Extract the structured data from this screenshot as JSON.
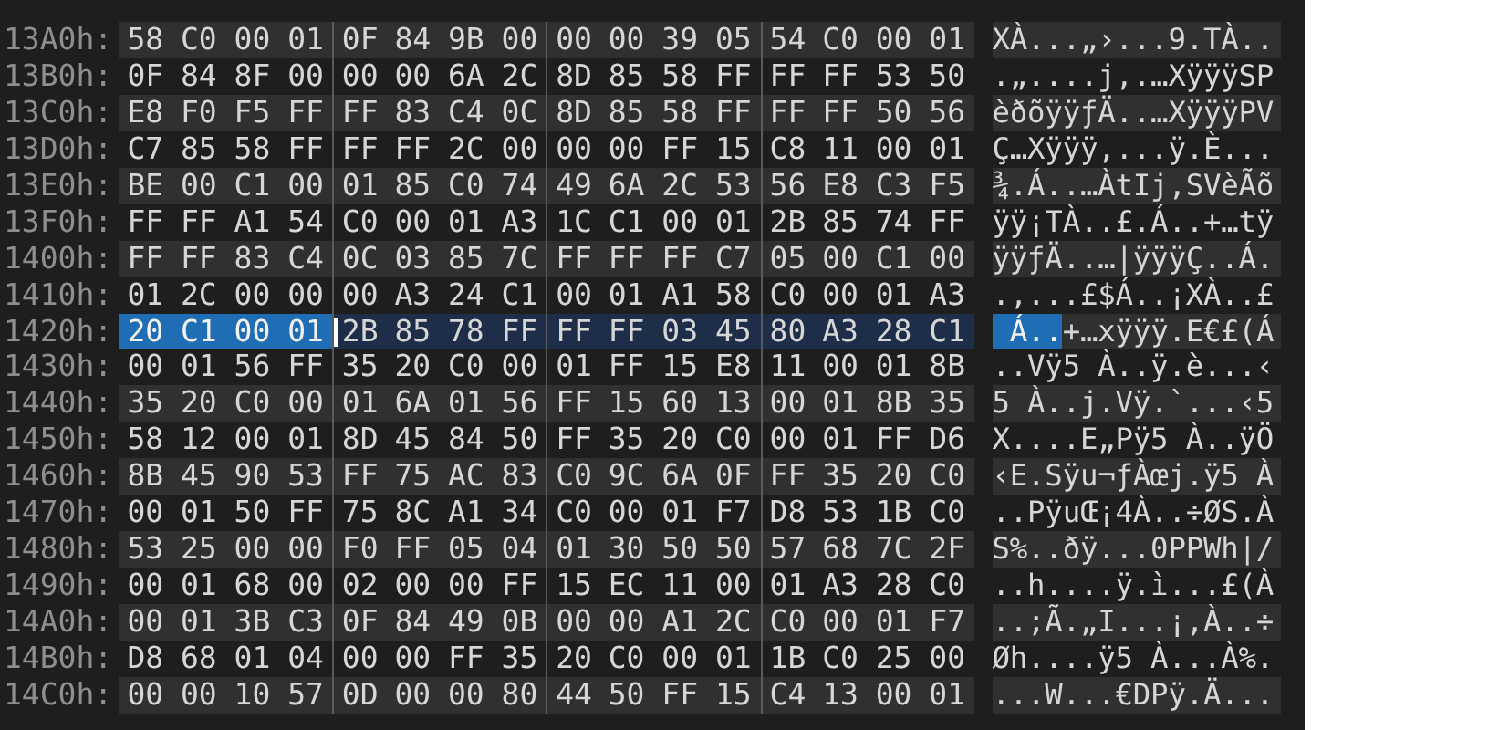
{
  "rows": [
    {
      "offset": "13A0h:",
      "current": false,
      "bytes": [
        {
          "hex": "58",
          "selected": false
        },
        {
          "hex": "C0",
          "selected": false
        },
        {
          "hex": "00",
          "selected": false
        },
        {
          "hex": "01",
          "selected": false
        },
        {
          "hex": "0F",
          "selected": false
        },
        {
          "hex": "84",
          "selected": false
        },
        {
          "hex": "9B",
          "selected": false
        },
        {
          "hex": "00",
          "selected": false
        },
        {
          "hex": "00",
          "selected": false
        },
        {
          "hex": "00",
          "selected": false
        },
        {
          "hex": "39",
          "selected": false
        },
        {
          "hex": "05",
          "selected": false
        },
        {
          "hex": "54",
          "selected": false
        },
        {
          "hex": "C0",
          "selected": false
        },
        {
          "hex": "00",
          "selected": false
        },
        {
          "hex": "01",
          "selected": false
        }
      ],
      "ascii": "XÀ...„›...9.TÀ.."
    },
    {
      "offset": "13B0h:",
      "current": false,
      "bytes": [
        {
          "hex": "0F",
          "selected": false
        },
        {
          "hex": "84",
          "selected": false
        },
        {
          "hex": "8F",
          "selected": false
        },
        {
          "hex": "00",
          "selected": false
        },
        {
          "hex": "00",
          "selected": false
        },
        {
          "hex": "00",
          "selected": false
        },
        {
          "hex": "6A",
          "selected": false
        },
        {
          "hex": "2C",
          "selected": false
        },
        {
          "hex": "8D",
          "selected": false
        },
        {
          "hex": "85",
          "selected": false
        },
        {
          "hex": "58",
          "selected": false
        },
        {
          "hex": "FF",
          "selected": false
        },
        {
          "hex": "FF",
          "selected": false
        },
        {
          "hex": "FF",
          "selected": false
        },
        {
          "hex": "53",
          "selected": false
        },
        {
          "hex": "50",
          "selected": false
        }
      ],
      "ascii": ".„....j,.…XÿÿÿSP"
    },
    {
      "offset": "13C0h:",
      "current": false,
      "bytes": [
        {
          "hex": "E8",
          "selected": false
        },
        {
          "hex": "F0",
          "selected": false
        },
        {
          "hex": "F5",
          "selected": false
        },
        {
          "hex": "FF",
          "selected": false
        },
        {
          "hex": "FF",
          "selected": false
        },
        {
          "hex": "83",
          "selected": false
        },
        {
          "hex": "C4",
          "selected": false
        },
        {
          "hex": "0C",
          "selected": false
        },
        {
          "hex": "8D",
          "selected": false
        },
        {
          "hex": "85",
          "selected": false
        },
        {
          "hex": "58",
          "selected": false
        },
        {
          "hex": "FF",
          "selected": false
        },
        {
          "hex": "FF",
          "selected": false
        },
        {
          "hex": "FF",
          "selected": false
        },
        {
          "hex": "50",
          "selected": false
        },
        {
          "hex": "56",
          "selected": false
        }
      ],
      "ascii": "èðõÿÿƒÄ..…XÿÿÿPV"
    },
    {
      "offset": "13D0h:",
      "current": false,
      "bytes": [
        {
          "hex": "C7",
          "selected": false
        },
        {
          "hex": "85",
          "selected": false
        },
        {
          "hex": "58",
          "selected": false
        },
        {
          "hex": "FF",
          "selected": false
        },
        {
          "hex": "FF",
          "selected": false
        },
        {
          "hex": "FF",
          "selected": false
        },
        {
          "hex": "2C",
          "selected": false
        },
        {
          "hex": "00",
          "selected": false
        },
        {
          "hex": "00",
          "selected": false
        },
        {
          "hex": "00",
          "selected": false
        },
        {
          "hex": "FF",
          "selected": false
        },
        {
          "hex": "15",
          "selected": false
        },
        {
          "hex": "C8",
          "selected": false
        },
        {
          "hex": "11",
          "selected": false
        },
        {
          "hex": "00",
          "selected": false
        },
        {
          "hex": "01",
          "selected": false
        }
      ],
      "ascii": "Ç…Xÿÿÿ,...ÿ.È..."
    },
    {
      "offset": "13E0h:",
      "current": false,
      "bytes": [
        {
          "hex": "BE",
          "selected": false
        },
        {
          "hex": "00",
          "selected": false
        },
        {
          "hex": "C1",
          "selected": false
        },
        {
          "hex": "00",
          "selected": false
        },
        {
          "hex": "01",
          "selected": false
        },
        {
          "hex": "85",
          "selected": false
        },
        {
          "hex": "C0",
          "selected": false
        },
        {
          "hex": "74",
          "selected": false
        },
        {
          "hex": "49",
          "selected": false
        },
        {
          "hex": "6A",
          "selected": false
        },
        {
          "hex": "2C",
          "selected": false
        },
        {
          "hex": "53",
          "selected": false
        },
        {
          "hex": "56",
          "selected": false
        },
        {
          "hex": "E8",
          "selected": false
        },
        {
          "hex": "C3",
          "selected": false
        },
        {
          "hex": "F5",
          "selected": false
        }
      ],
      "ascii": "¾.Á..…ÀtIj,SVèÃõ"
    },
    {
      "offset": "13F0h:",
      "current": false,
      "bytes": [
        {
          "hex": "FF",
          "selected": false
        },
        {
          "hex": "FF",
          "selected": false
        },
        {
          "hex": "A1",
          "selected": false
        },
        {
          "hex": "54",
          "selected": false
        },
        {
          "hex": "C0",
          "selected": false
        },
        {
          "hex": "00",
          "selected": false
        },
        {
          "hex": "01",
          "selected": false
        },
        {
          "hex": "A3",
          "selected": false
        },
        {
          "hex": "1C",
          "selected": false
        },
        {
          "hex": "C1",
          "selected": false
        },
        {
          "hex": "00",
          "selected": false
        },
        {
          "hex": "01",
          "selected": false
        },
        {
          "hex": "2B",
          "selected": false
        },
        {
          "hex": "85",
          "selected": false
        },
        {
          "hex": "74",
          "selected": false
        },
        {
          "hex": "FF",
          "selected": false
        }
      ],
      "ascii": "ÿÿ¡TÀ..£.Á..+…tÿ"
    },
    {
      "offset": "1400h:",
      "current": false,
      "bytes": [
        {
          "hex": "FF",
          "selected": false
        },
        {
          "hex": "FF",
          "selected": false
        },
        {
          "hex": "83",
          "selected": false
        },
        {
          "hex": "C4",
          "selected": false
        },
        {
          "hex": "0C",
          "selected": false
        },
        {
          "hex": "03",
          "selected": false
        },
        {
          "hex": "85",
          "selected": false
        },
        {
          "hex": "7C",
          "selected": false
        },
        {
          "hex": "FF",
          "selected": false
        },
        {
          "hex": "FF",
          "selected": false
        },
        {
          "hex": "FF",
          "selected": false
        },
        {
          "hex": "C7",
          "selected": false
        },
        {
          "hex": "05",
          "selected": false
        },
        {
          "hex": "00",
          "selected": false
        },
        {
          "hex": "C1",
          "selected": false
        },
        {
          "hex": "00",
          "selected": false
        }
      ],
      "ascii": "ÿÿƒÄ..…|ÿÿÿÇ..Á."
    },
    {
      "offset": "1410h:",
      "current": false,
      "bytes": [
        {
          "hex": "01",
          "selected": false
        },
        {
          "hex": "2C",
          "selected": false
        },
        {
          "hex": "00",
          "selected": false
        },
        {
          "hex": "00",
          "selected": false
        },
        {
          "hex": "00",
          "selected": false
        },
        {
          "hex": "A3",
          "selected": false
        },
        {
          "hex": "24",
          "selected": false
        },
        {
          "hex": "C1",
          "selected": false
        },
        {
          "hex": "00",
          "selected": false
        },
        {
          "hex": "01",
          "selected": false
        },
        {
          "hex": "A1",
          "selected": false
        },
        {
          "hex": "58",
          "selected": false
        },
        {
          "hex": "C0",
          "selected": false
        },
        {
          "hex": "00",
          "selected": false
        },
        {
          "hex": "01",
          "selected": false
        },
        {
          "hex": "A3",
          "selected": false
        }
      ],
      "ascii": ".,...£$Á..¡XÀ..£"
    },
    {
      "offset": "1420h:",
      "current": true,
      "bytes": [
        {
          "hex": "20",
          "selected": true
        },
        {
          "hex": "C1",
          "selected": true
        },
        {
          "hex": "00",
          "selected": true
        },
        {
          "hex": "01",
          "selected": true
        },
        {
          "hex": "2B",
          "selected": false
        },
        {
          "hex": "85",
          "selected": false
        },
        {
          "hex": "78",
          "selected": false
        },
        {
          "hex": "FF",
          "selected": false
        },
        {
          "hex": "FF",
          "selected": false
        },
        {
          "hex": "FF",
          "selected": false
        },
        {
          "hex": "03",
          "selected": false
        },
        {
          "hex": "45",
          "selected": false
        },
        {
          "hex": "80",
          "selected": false
        },
        {
          "hex": "A3",
          "selected": false
        },
        {
          "hex": "28",
          "selected": false
        },
        {
          "hex": "C1",
          "selected": false
        }
      ],
      "ascii": " Á..+…xÿÿÿ.E€£(Á"
    },
    {
      "offset": "1430h:",
      "current": false,
      "bytes": [
        {
          "hex": "00",
          "selected": false
        },
        {
          "hex": "01",
          "selected": false
        },
        {
          "hex": "56",
          "selected": false
        },
        {
          "hex": "FF",
          "selected": false
        },
        {
          "hex": "35",
          "selected": false
        },
        {
          "hex": "20",
          "selected": false
        },
        {
          "hex": "C0",
          "selected": false
        },
        {
          "hex": "00",
          "selected": false
        },
        {
          "hex": "01",
          "selected": false
        },
        {
          "hex": "FF",
          "selected": false
        },
        {
          "hex": "15",
          "selected": false
        },
        {
          "hex": "E8",
          "selected": false
        },
        {
          "hex": "11",
          "selected": false
        },
        {
          "hex": "00",
          "selected": false
        },
        {
          "hex": "01",
          "selected": false
        },
        {
          "hex": "8B",
          "selected": false
        }
      ],
      "ascii": "..Vÿ5 À..ÿ.è...‹"
    },
    {
      "offset": "1440h:",
      "current": false,
      "bytes": [
        {
          "hex": "35",
          "selected": false
        },
        {
          "hex": "20",
          "selected": false
        },
        {
          "hex": "C0",
          "selected": false
        },
        {
          "hex": "00",
          "selected": false
        },
        {
          "hex": "01",
          "selected": false
        },
        {
          "hex": "6A",
          "selected": false
        },
        {
          "hex": "01",
          "selected": false
        },
        {
          "hex": "56",
          "selected": false
        },
        {
          "hex": "FF",
          "selected": false
        },
        {
          "hex": "15",
          "selected": false
        },
        {
          "hex": "60",
          "selected": false
        },
        {
          "hex": "13",
          "selected": false
        },
        {
          "hex": "00",
          "selected": false
        },
        {
          "hex": "01",
          "selected": false
        },
        {
          "hex": "8B",
          "selected": false
        },
        {
          "hex": "35",
          "selected": false
        }
      ],
      "ascii": "5 À..j.Vÿ.`...‹5"
    },
    {
      "offset": "1450h:",
      "current": false,
      "bytes": [
        {
          "hex": "58",
          "selected": false
        },
        {
          "hex": "12",
          "selected": false
        },
        {
          "hex": "00",
          "selected": false
        },
        {
          "hex": "01",
          "selected": false
        },
        {
          "hex": "8D",
          "selected": false
        },
        {
          "hex": "45",
          "selected": false
        },
        {
          "hex": "84",
          "selected": false
        },
        {
          "hex": "50",
          "selected": false
        },
        {
          "hex": "FF",
          "selected": false
        },
        {
          "hex": "35",
          "selected": false
        },
        {
          "hex": "20",
          "selected": false
        },
        {
          "hex": "C0",
          "selected": false
        },
        {
          "hex": "00",
          "selected": false
        },
        {
          "hex": "01",
          "selected": false
        },
        {
          "hex": "FF",
          "selected": false
        },
        {
          "hex": "D6",
          "selected": false
        }
      ],
      "ascii": "X....E„Pÿ5 À..ÿÖ"
    },
    {
      "offset": "1460h:",
      "current": false,
      "bytes": [
        {
          "hex": "8B",
          "selected": false
        },
        {
          "hex": "45",
          "selected": false
        },
        {
          "hex": "90",
          "selected": false
        },
        {
          "hex": "53",
          "selected": false
        },
        {
          "hex": "FF",
          "selected": false
        },
        {
          "hex": "75",
          "selected": false
        },
        {
          "hex": "AC",
          "selected": false
        },
        {
          "hex": "83",
          "selected": false
        },
        {
          "hex": "C0",
          "selected": false
        },
        {
          "hex": "9C",
          "selected": false
        },
        {
          "hex": "6A",
          "selected": false
        },
        {
          "hex": "0F",
          "selected": false
        },
        {
          "hex": "FF",
          "selected": false
        },
        {
          "hex": "35",
          "selected": false
        },
        {
          "hex": "20",
          "selected": false
        },
        {
          "hex": "C0",
          "selected": false
        }
      ],
      "ascii": "‹E.Sÿu¬ƒÀœj.ÿ5 À"
    },
    {
      "offset": "1470h:",
      "current": false,
      "bytes": [
        {
          "hex": "00",
          "selected": false
        },
        {
          "hex": "01",
          "selected": false
        },
        {
          "hex": "50",
          "selected": false
        },
        {
          "hex": "FF",
          "selected": false
        },
        {
          "hex": "75",
          "selected": false
        },
        {
          "hex": "8C",
          "selected": false
        },
        {
          "hex": "A1",
          "selected": false
        },
        {
          "hex": "34",
          "selected": false
        },
        {
          "hex": "C0",
          "selected": false
        },
        {
          "hex": "00",
          "selected": false
        },
        {
          "hex": "01",
          "selected": false
        },
        {
          "hex": "F7",
          "selected": false
        },
        {
          "hex": "D8",
          "selected": false
        },
        {
          "hex": "53",
          "selected": false
        },
        {
          "hex": "1B",
          "selected": false
        },
        {
          "hex": "C0",
          "selected": false
        }
      ],
      "ascii": "..PÿuŒ¡4À..÷ØS.À"
    },
    {
      "offset": "1480h:",
      "current": false,
      "bytes": [
        {
          "hex": "53",
          "selected": false
        },
        {
          "hex": "25",
          "selected": false
        },
        {
          "hex": "00",
          "selected": false
        },
        {
          "hex": "00",
          "selected": false
        },
        {
          "hex": "F0",
          "selected": false
        },
        {
          "hex": "FF",
          "selected": false
        },
        {
          "hex": "05",
          "selected": false
        },
        {
          "hex": "04",
          "selected": false
        },
        {
          "hex": "01",
          "selected": false
        },
        {
          "hex": "30",
          "selected": false
        },
        {
          "hex": "50",
          "selected": false
        },
        {
          "hex": "50",
          "selected": false
        },
        {
          "hex": "57",
          "selected": false
        },
        {
          "hex": "68",
          "selected": false
        },
        {
          "hex": "7C",
          "selected": false
        },
        {
          "hex": "2F",
          "selected": false
        }
      ],
      "ascii": "S%..ðÿ...0PPWh|/"
    },
    {
      "offset": "1490h:",
      "current": false,
      "bytes": [
        {
          "hex": "00",
          "selected": false
        },
        {
          "hex": "01",
          "selected": false
        },
        {
          "hex": "68",
          "selected": false
        },
        {
          "hex": "00",
          "selected": false
        },
        {
          "hex": "02",
          "selected": false
        },
        {
          "hex": "00",
          "selected": false
        },
        {
          "hex": "00",
          "selected": false
        },
        {
          "hex": "FF",
          "selected": false
        },
        {
          "hex": "15",
          "selected": false
        },
        {
          "hex": "EC",
          "selected": false
        },
        {
          "hex": "11",
          "selected": false
        },
        {
          "hex": "00",
          "selected": false
        },
        {
          "hex": "01",
          "selected": false
        },
        {
          "hex": "A3",
          "selected": false
        },
        {
          "hex": "28",
          "selected": false
        },
        {
          "hex": "C0",
          "selected": false
        }
      ],
      "ascii": "..h....ÿ.ì...£(À"
    },
    {
      "offset": "14A0h:",
      "current": false,
      "bytes": [
        {
          "hex": "00",
          "selected": false
        },
        {
          "hex": "01",
          "selected": false
        },
        {
          "hex": "3B",
          "selected": false
        },
        {
          "hex": "C3",
          "selected": false
        },
        {
          "hex": "0F",
          "selected": false
        },
        {
          "hex": "84",
          "selected": false
        },
        {
          "hex": "49",
          "selected": false
        },
        {
          "hex": "0B",
          "selected": false
        },
        {
          "hex": "00",
          "selected": false
        },
        {
          "hex": "00",
          "selected": false
        },
        {
          "hex": "A1",
          "selected": false
        },
        {
          "hex": "2C",
          "selected": false
        },
        {
          "hex": "C0",
          "selected": false
        },
        {
          "hex": "00",
          "selected": false
        },
        {
          "hex": "01",
          "selected": false
        },
        {
          "hex": "F7",
          "selected": false
        }
      ],
      "ascii": "..;Ã.„I...¡,À..÷"
    },
    {
      "offset": "14B0h:",
      "current": false,
      "bytes": [
        {
          "hex": "D8",
          "selected": false
        },
        {
          "hex": "68",
          "selected": false
        },
        {
          "hex": "01",
          "selected": false
        },
        {
          "hex": "04",
          "selected": false
        },
        {
          "hex": "00",
          "selected": false
        },
        {
          "hex": "00",
          "selected": false
        },
        {
          "hex": "FF",
          "selected": false
        },
        {
          "hex": "35",
          "selected": false
        },
        {
          "hex": "20",
          "selected": false
        },
        {
          "hex": "C0",
          "selected": false
        },
        {
          "hex": "00",
          "selected": false
        },
        {
          "hex": "01",
          "selected": false
        },
        {
          "hex": "1B",
          "selected": false
        },
        {
          "hex": "C0",
          "selected": false
        },
        {
          "hex": "25",
          "selected": false
        },
        {
          "hex": "00",
          "selected": false
        }
      ],
      "ascii": "Øh....ÿ5 À...À%."
    },
    {
      "offset": "14C0h:",
      "current": false,
      "bytes": [
        {
          "hex": "00",
          "selected": false
        },
        {
          "hex": "00",
          "selected": false
        },
        {
          "hex": "10",
          "selected": false
        },
        {
          "hex": "57",
          "selected": false
        },
        {
          "hex": "0D",
          "selected": false
        },
        {
          "hex": "00",
          "selected": false
        },
        {
          "hex": "00",
          "selected": false
        },
        {
          "hex": "80",
          "selected": false
        },
        {
          "hex": "44",
          "selected": false
        },
        {
          "hex": "50",
          "selected": false
        },
        {
          "hex": "FF",
          "selected": false
        },
        {
          "hex": "15",
          "selected": false
        },
        {
          "hex": "C4",
          "selected": false
        },
        {
          "hex": "13",
          "selected": false
        },
        {
          "hex": "00",
          "selected": false
        },
        {
          "hex": "01",
          "selected": false
        }
      ],
      "ascii": "...W...€DPÿ.Ä..."
    }
  ]
}
